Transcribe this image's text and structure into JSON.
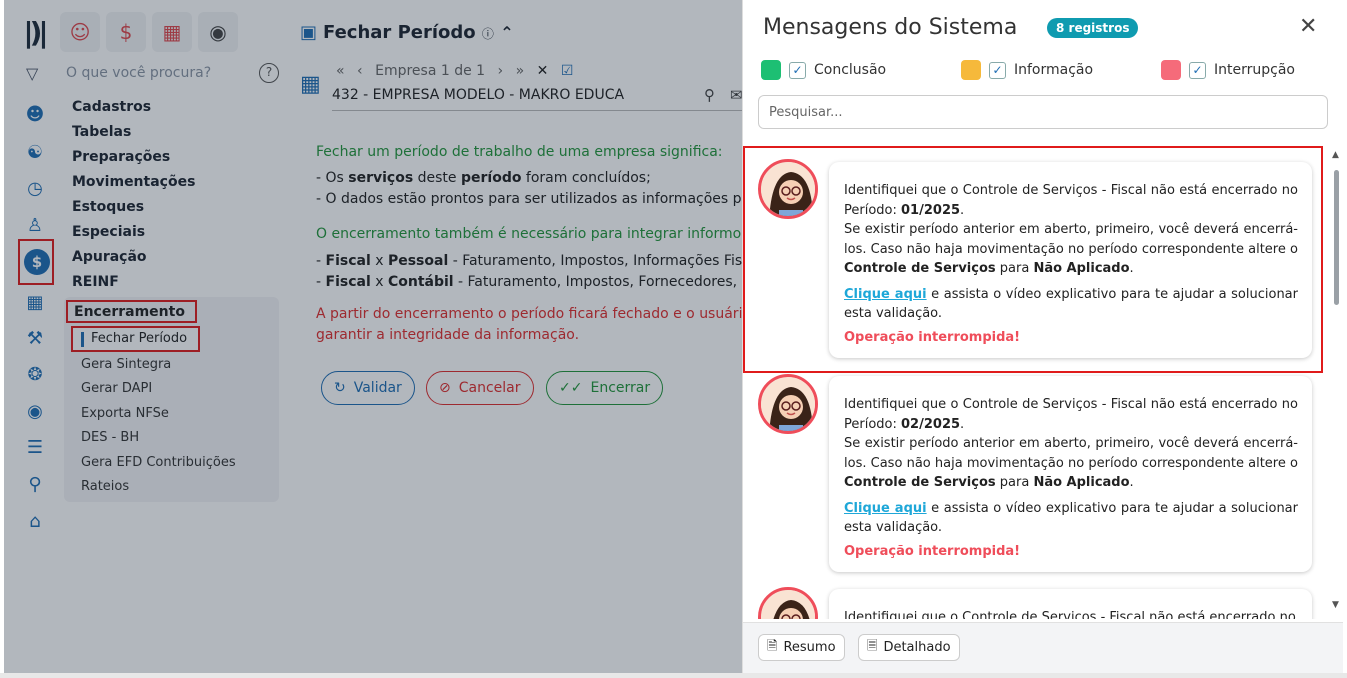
{
  "left": {
    "search_placeholder": "O que você procura?",
    "menu": [
      "Cadastros",
      "Tabelas",
      "Preparações",
      "Movimentações",
      "Estoques",
      "Especiais",
      "Apuração",
      "REINF"
    ],
    "submenu_header": "Encerramento",
    "submenu_selected": "Fechar Período",
    "submenu_items": [
      "Gera Sintegra",
      "Gerar DAPI",
      "Exporta NFSe",
      "DES - BH",
      "Gera EFD Contribuições",
      "Rateios"
    ]
  },
  "page": {
    "title": "Fechar Período",
    "company_nav": "Empresa 1 de 1",
    "company": "432 - EMPRESA MODELO - MAKRO EDUCA",
    "line1": "Fechar um período de trabalho de uma empresa significa:",
    "line2a": "- Os ",
    "line2b": "serviços",
    "line2c": " deste ",
    "line2d": "período",
    "line2e": " foram concluídos;",
    "line3": "- O dados estão prontos para ser utilizados as informações p",
    "line4": "O encerramento também é necessário para integrar informo",
    "line5a": "- ",
    "line5b": "Fiscal",
    "line5c": " x ",
    "line5d": "Pessoal",
    "line5e": " - Faturamento, Impostos, Informações Fisca",
    "line6a": "- ",
    "line6b": "Fiscal",
    "line6c": " x ",
    "line6d": "Contábil",
    "line6e": " - Faturamento, Impostos, Fornecedores, Cl",
    "line7": "A partir do encerramento o período ficará fechado e o usuári",
    "line8": "garantir a integridade da informação.",
    "btn_validar": "Validar",
    "btn_cancelar": "Cancelar",
    "btn_encerrar": "Encerrar"
  },
  "panel": {
    "title": "Mensagens do Sistema",
    "badge": "8 registros",
    "legend": [
      {
        "label": "Conclusão",
        "color": "#1dbf73"
      },
      {
        "label": "Informação",
        "color": "#f6b93b"
      },
      {
        "label": "Interrupção",
        "color": "#f56b7a"
      }
    ],
    "search_placeholder": "Pesquisar...",
    "messages": [
      {
        "p1": "Identifiquei que o Controle de Serviços - Fiscal não está encerrado no Período: ",
        "period": "01/2025",
        "p2": "Se existir período anterior em aberto, primeiro, você deverá encerrá-los. Caso não haja movimentação no período correspondente altere o ",
        "ctrl": "Controle de Serviços",
        "p3": " para ",
        "na": "Não Aplicado",
        "link": "Clique aqui",
        "p4": " e assista o vídeo explicativo para te ajudar a solucionar esta validação.",
        "status": "Operação interrompida!"
      },
      {
        "p1": "Identifiquei que o Controle de Serviços - Fiscal não está encerrado no Período: ",
        "period": "02/2025",
        "p2": "Se existir período anterior em aberto, primeiro, você deverá encerrá-los. Caso não haja movimentação no período correspondente altere o ",
        "ctrl": "Controle de Serviços",
        "p3": " para ",
        "na": "Não Aplicado",
        "link": "Clique aqui",
        "p4": " e assista o vídeo explicativo para te ajudar a solucionar esta validação.",
        "status": "Operação interrompida!"
      },
      {
        "p1": "Identifiquei que o Controle de Serviços - Fiscal não está encerrado no"
      }
    ],
    "footer": {
      "resumo": "Resumo",
      "detalhado": "Detalhado"
    }
  }
}
